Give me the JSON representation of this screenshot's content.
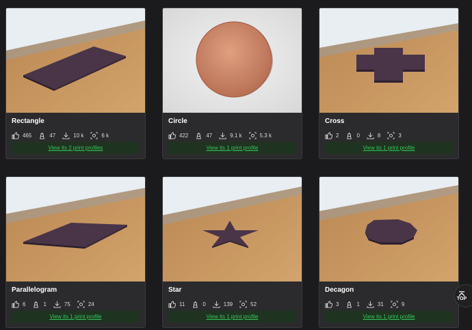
{
  "cards": [
    {
      "title": "Rectangle",
      "likes": "465",
      "makes": "47",
      "downloads": "10 k",
      "views": "6 k",
      "profiles_link": "View its 2 print profiles",
      "shape": "rectangle"
    },
    {
      "title": "Circle",
      "likes": "422",
      "makes": "47",
      "downloads": "9.1 k",
      "views": "5.3 k",
      "profiles_link": "View its 1 print profile",
      "shape": "circle"
    },
    {
      "title": "Cross",
      "likes": "2",
      "makes": "0",
      "downloads": "8",
      "views": "3",
      "profiles_link": "View its 1 print profile",
      "shape": "cross"
    },
    {
      "title": "Parallelogram",
      "likes": "6",
      "makes": "1",
      "downloads": "75",
      "views": "24",
      "profiles_link": "View its 1 print profile",
      "shape": "parallelogram"
    },
    {
      "title": "Star",
      "likes": "11",
      "makes": "0",
      "downloads": "139",
      "views": "52",
      "profiles_link": "View its 1 print profile",
      "shape": "star"
    },
    {
      "title": "Decagon",
      "likes": "3",
      "makes": "1",
      "downloads": "31",
      "views": "9",
      "profiles_link": "View its 1 print profile",
      "shape": "decagon"
    }
  ],
  "back_to_top": {
    "label": "TOP",
    "icon": "chevron-up-icon"
  },
  "colors": {
    "link_green": "#34c65a",
    "link_bg": "#1f3321",
    "card_bg": "#2b2b2d",
    "page_bg": "#1b1b1d"
  }
}
